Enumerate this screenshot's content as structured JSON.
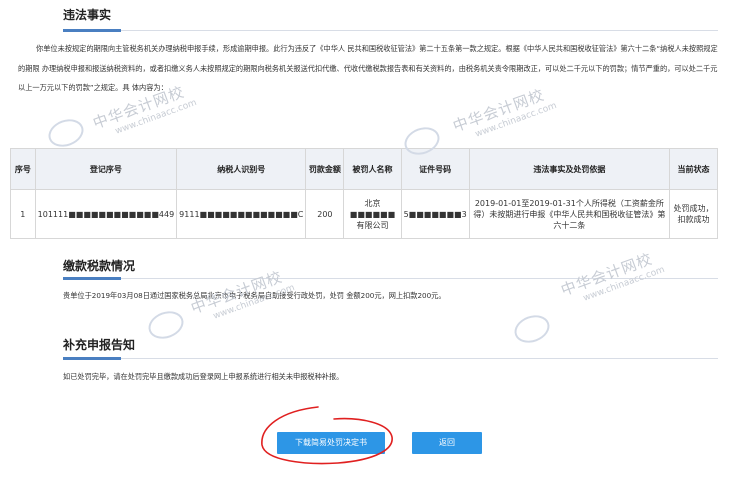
{
  "sections": {
    "violation": {
      "title": "违法事实",
      "text": "你单位未按规定的期限向主管税务机关办理纳税申报手续，形成逾期申报。此行为违反了《中华人 民共和国税收征管法》第二十五条第一款之规定。根据《中华人民共和国税收征管法》第六十二条“纳税人未按照规定的期限 办理纳税申报和报送纳税资料的，或者扣缴义务人未按照规定的期限向税务机关报送代扣代缴、代收代缴税款报告表和有关资料的，由税务机关责令限期改正，可以处二千元以下的罚款；情节严重的，可以处二千元以上一万元以下的罚款”之规定。具 体内容为："
    },
    "payment": {
      "title": "缴款税款情况",
      "text": "贵单位于2019年03月08日通过国家税务总局北京市电子税务局自助接受行政处罚，处罚 金额200元，网上扣款200元。"
    },
    "supplement": {
      "title": "补充申报告知",
      "text": "如已处罚完毕，请在处罚完毕且缴款成功后登录网上申报系统进行相关未申报税种补报。"
    }
  },
  "table": {
    "headers": [
      "序号",
      "登记序号",
      "纳税人识别号",
      "罚款金额",
      "被罚人名称",
      "证件号码",
      "违法事实及处罚依据",
      "当前状态"
    ],
    "rows": [
      [
        "1",
        "101111■■■■■■■■■■■■449",
        "9111■■■■■■■■■■■■■C",
        "200",
        "北京■■■■■■有限公司",
        "5■■■■■■■3",
        "2019-01-01至2019-01-31个人所得税（工资薪金所得）未按期进行申报《中华人民共和国税收征管法》第六十二条",
        "处罚成功，扣款成功"
      ]
    ]
  },
  "buttons": {
    "download": "下载简易处罚决定书",
    "back": "返回"
  },
  "watermark": {
    "cn": "中华会计网校",
    "en": "www.chinaacc.com"
  },
  "colors": {
    "accent": "#2d96e6",
    "section_mark": "#4a7fc1",
    "annotation": "#e02020"
  }
}
